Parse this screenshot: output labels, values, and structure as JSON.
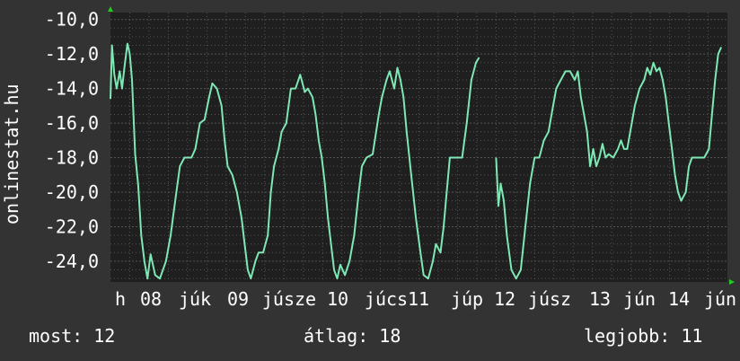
{
  "chart_data": {
    "type": "line",
    "watermark": "onlinestat.hu",
    "ylim": [
      -25.2,
      -9.6
    ],
    "y_ticks": [
      "-10,0",
      "-12,0",
      "-14,0",
      "-16,0",
      "-18,0",
      "-20,0",
      "-22,0",
      "-24,0"
    ],
    "y_tick_values": [
      -10,
      -12,
      -14,
      -16,
      -18,
      -20,
      -22,
      -24
    ],
    "x_ticks": [
      "h",
      "08",
      "júk",
      "09",
      "júsze",
      "10",
      "júcs",
      "11",
      "júp",
      "12",
      "júsz",
      "13",
      "jún",
      "14",
      "jún"
    ],
    "grid": true,
    "series": [
      {
        "color": "#7ee8b4",
        "points": [
          [
            0.0,
            -14.6
          ],
          [
            0.02,
            -11.5
          ],
          [
            0.05,
            -13.2
          ],
          [
            0.08,
            -14.0
          ],
          [
            0.12,
            -13.0
          ],
          [
            0.15,
            -14.0
          ],
          [
            0.18,
            -12.8
          ],
          [
            0.22,
            -11.4
          ],
          [
            0.25,
            -12.0
          ],
          [
            0.28,
            -13.5
          ],
          [
            0.32,
            -17.8
          ],
          [
            0.36,
            -19.6
          ],
          [
            0.4,
            -22.5
          ],
          [
            0.44,
            -24.0
          ],
          [
            0.48,
            -25.0
          ],
          [
            0.52,
            -23.6
          ],
          [
            0.58,
            -24.8
          ],
          [
            0.64,
            -25.0
          ],
          [
            0.72,
            -24.0
          ],
          [
            0.78,
            -22.5
          ],
          [
            0.84,
            -20.5
          ],
          [
            0.9,
            -18.5
          ],
          [
            0.96,
            -18.0
          ],
          [
            1.05,
            -18.0
          ],
          [
            1.1,
            -17.5
          ],
          [
            1.16,
            -16.0
          ],
          [
            1.22,
            -15.8
          ],
          [
            1.28,
            -14.5
          ],
          [
            1.32,
            -13.7
          ],
          [
            1.38,
            -14.0
          ],
          [
            1.44,
            -15.0
          ],
          [
            1.48,
            -17.0
          ],
          [
            1.52,
            -18.5
          ],
          [
            1.58,
            -19.0
          ],
          [
            1.64,
            -20.0
          ],
          [
            1.7,
            -21.5
          ],
          [
            1.74,
            -23.0
          ],
          [
            1.78,
            -24.5
          ],
          [
            1.82,
            -25.0
          ],
          [
            1.88,
            -24.0
          ],
          [
            1.92,
            -23.5
          ],
          [
            1.98,
            -23.5
          ],
          [
            2.04,
            -22.5
          ],
          [
            2.08,
            -20.0
          ],
          [
            2.12,
            -18.5
          ],
          [
            2.18,
            -17.5
          ],
          [
            2.22,
            -16.5
          ],
          [
            2.28,
            -16.0
          ],
          [
            2.34,
            -14.0
          ],
          [
            2.4,
            -14.0
          ],
          [
            2.46,
            -13.2
          ],
          [
            2.52,
            -14.2
          ],
          [
            2.56,
            -14.0
          ],
          [
            2.62,
            -14.5
          ],
          [
            2.66,
            -15.5
          ],
          [
            2.7,
            -17.0
          ],
          [
            2.74,
            -18.0
          ],
          [
            2.78,
            -19.5
          ],
          [
            2.82,
            -21.5
          ],
          [
            2.86,
            -23.0
          ],
          [
            2.9,
            -24.5
          ],
          [
            2.94,
            -25.0
          ],
          [
            2.98,
            -24.2
          ],
          [
            3.04,
            -24.8
          ],
          [
            3.1,
            -24.0
          ],
          [
            3.16,
            -22.5
          ],
          [
            3.22,
            -20.0
          ],
          [
            3.26,
            -18.5
          ],
          [
            3.32,
            -18.0
          ],
          [
            3.4,
            -17.8
          ],
          [
            3.48,
            -15.5
          ],
          [
            3.52,
            -14.5
          ],
          [
            3.58,
            -13.5
          ],
          [
            3.62,
            -13.0
          ],
          [
            3.68,
            -14.0
          ],
          [
            3.72,
            -12.8
          ],
          [
            3.76,
            -13.5
          ],
          [
            3.8,
            -14.5
          ],
          [
            3.84,
            -16.5
          ],
          [
            3.9,
            -19.0
          ],
          [
            3.96,
            -21.5
          ],
          [
            4.02,
            -23.5
          ],
          [
            4.06,
            -24.8
          ],
          [
            4.12,
            -25.0
          ],
          [
            4.18,
            -24.0
          ],
          [
            4.22,
            -23.0
          ],
          [
            4.28,
            -23.5
          ],
          [
            4.32,
            -22.0
          ],
          [
            4.36,
            -20.0
          ],
          [
            4.4,
            -18.0
          ],
          [
            4.5,
            -18.0
          ],
          [
            4.56,
            -18.0
          ],
          [
            4.62,
            -16.0
          ],
          [
            4.68,
            -13.5
          ],
          [
            4.74,
            -12.5
          ],
          [
            4.78,
            -12.2
          ]
        ]
      },
      {
        "color": "#7ee8b4",
        "points": [
          [
            5.0,
            -18.0
          ],
          [
            5.03,
            -20.8
          ],
          [
            5.06,
            -19.5
          ],
          [
            5.1,
            -20.5
          ],
          [
            5.14,
            -22.5
          ],
          [
            5.2,
            -24.5
          ],
          [
            5.26,
            -25.0
          ],
          [
            5.32,
            -24.5
          ],
          [
            5.38,
            -22.0
          ],
          [
            5.44,
            -19.5
          ],
          [
            5.5,
            -18.0
          ],
          [
            5.56,
            -18.0
          ],
          [
            5.62,
            -17.0
          ],
          [
            5.68,
            -16.5
          ],
          [
            5.74,
            -15.0
          ],
          [
            5.78,
            -14.0
          ],
          [
            5.84,
            -13.5
          ],
          [
            5.9,
            -13.0
          ],
          [
            5.96,
            -13.0
          ],
          [
            6.02,
            -13.5
          ],
          [
            6.06,
            -13.0
          ],
          [
            6.1,
            -14.5
          ],
          [
            6.14,
            -15.5
          ],
          [
            6.18,
            -16.5
          ],
          [
            6.22,
            -18.5
          ],
          [
            6.26,
            -17.5
          ],
          [
            6.3,
            -18.5
          ],
          [
            6.34,
            -18.0
          ],
          [
            6.38,
            -17.2
          ],
          [
            6.42,
            -18.0
          ],
          [
            6.46,
            -17.8
          ],
          [
            6.52,
            -18.0
          ],
          [
            6.58,
            -17.5
          ],
          [
            6.62,
            -17.0
          ],
          [
            6.66,
            -17.5
          ],
          [
            6.7,
            -17.5
          ],
          [
            6.76,
            -16.0
          ],
          [
            6.8,
            -15.0
          ],
          [
            6.86,
            -14.0
          ],
          [
            6.92,
            -13.5
          ],
          [
            6.96,
            -12.8
          ],
          [
            7.0,
            -13.2
          ],
          [
            7.04,
            -12.5
          ],
          [
            7.08,
            -13.0
          ],
          [
            7.12,
            -12.8
          ],
          [
            7.16,
            -13.5
          ],
          [
            7.2,
            -14.5
          ],
          [
            7.24,
            -16.0
          ],
          [
            7.28,
            -17.5
          ],
          [
            7.32,
            -19.0
          ],
          [
            7.36,
            -20.0
          ],
          [
            7.4,
            -20.5
          ],
          [
            7.46,
            -20.0
          ],
          [
            7.5,
            -18.5
          ],
          [
            7.54,
            -18.0
          ],
          [
            7.62,
            -18.0
          ],
          [
            7.7,
            -18.0
          ],
          [
            7.76,
            -17.5
          ],
          [
            7.8,
            -15.5
          ],
          [
            7.84,
            -13.5
          ],
          [
            7.88,
            -12.0
          ],
          [
            7.92,
            -11.6
          ]
        ]
      }
    ]
  },
  "stats": {
    "most": "most: 12",
    "atlag": "átlag: 18",
    "legjobb": "legjobb: 11"
  },
  "colors": {
    "background": "#333333",
    "plot_background": "#1f1f1f",
    "grid": "#555555",
    "line": "#7ee8b4",
    "axis_marker": "#22cc22",
    "text": "#ffffff"
  }
}
